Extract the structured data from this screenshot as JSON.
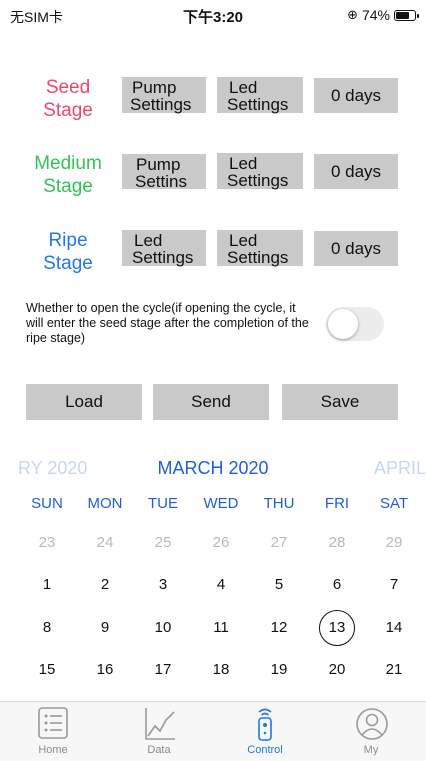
{
  "status_bar": {
    "carrier": "无SIM卡",
    "time": "下午3:20",
    "battery": "74%",
    "battery_level": 0.74
  },
  "stages": [
    {
      "name_line1": "Seed",
      "name_line2": "Stage",
      "color": "#f0466a",
      "btn1_line1": "Pump",
      "btn1_line2": "Settings",
      "btn2_line1": "Led",
      "btn2_line2": "Settings",
      "days": "0 days"
    },
    {
      "name_line1": "Medium",
      "name_line2": "Stage",
      "color": "#33c25a",
      "btn1_line1": "Pump",
      "btn1_line2": "Settins",
      "btn2_line1": "Led",
      "btn2_line2": "Settings",
      "days": "0 days"
    },
    {
      "name_line1": "Ripe",
      "name_line2": "Stage",
      "color": "#1f7ae0",
      "btn1_line1": "Led",
      "btn1_line2": "Settings",
      "btn2_line1": "Led",
      "btn2_line2": "Settings",
      "days": "0 days"
    }
  ],
  "cycle": {
    "text": "Whether to open the cycle(if opening the cycle, it will enter the seed stage after the completion of the ripe stage)",
    "enabled": false
  },
  "actions": {
    "load": "Load",
    "send": "Send",
    "save": "Save"
  },
  "calendar": {
    "prev_month": "RY 2020",
    "current_month": "MARCH 2020",
    "next_month": "APRIL",
    "weekdays": [
      "SUN",
      "MON",
      "TUE",
      "WED",
      "THU",
      "FRI",
      "SAT"
    ],
    "weeks": [
      [
        "23",
        "24",
        "25",
        "26",
        "27",
        "28",
        "29"
      ],
      [
        "1",
        "2",
        "3",
        "4",
        "5",
        "6",
        "7"
      ],
      [
        "8",
        "9",
        "10",
        "11",
        "12",
        "13",
        "14"
      ],
      [
        "15",
        "16",
        "17",
        "18",
        "19",
        "20",
        "21"
      ]
    ],
    "today": "13"
  },
  "tabs": [
    {
      "label": "Home",
      "icon": "list-icon"
    },
    {
      "label": "Data",
      "icon": "chart-icon"
    },
    {
      "label": "Control",
      "icon": "remote-icon"
    },
    {
      "label": "My",
      "icon": "user-icon"
    }
  ],
  "accent_color": "#1f7ae0"
}
